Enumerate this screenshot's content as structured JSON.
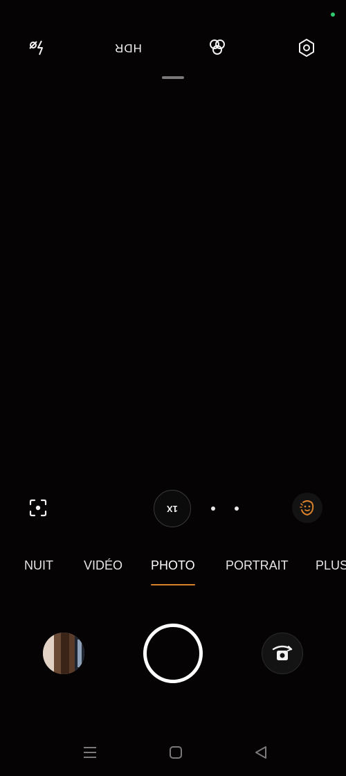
{
  "top_bar": {
    "flash_icon": "flash-off-icon",
    "hdr_label": "HDR",
    "filters_icon": "filters-icon",
    "settings_icon": "settings-icon"
  },
  "controls": {
    "zoom_label": "1X",
    "scan_icon": "scan-icon",
    "beauty_icon": "beauty-face-icon"
  },
  "modes": [
    {
      "label": "NUIT",
      "active": false
    },
    {
      "label": "VIDÉO",
      "active": false
    },
    {
      "label": "PHOTO",
      "active": true
    },
    {
      "label": "PORTRAIT",
      "active": false
    },
    {
      "label": "PLUS",
      "active": false
    }
  ],
  "colors": {
    "accent": "#d9822b",
    "background": "#050304",
    "status_dot": "#2ecc71"
  },
  "nav_bar": {
    "menu_icon": "menu-icon",
    "home_icon": "home-icon",
    "back_icon": "back-icon"
  }
}
